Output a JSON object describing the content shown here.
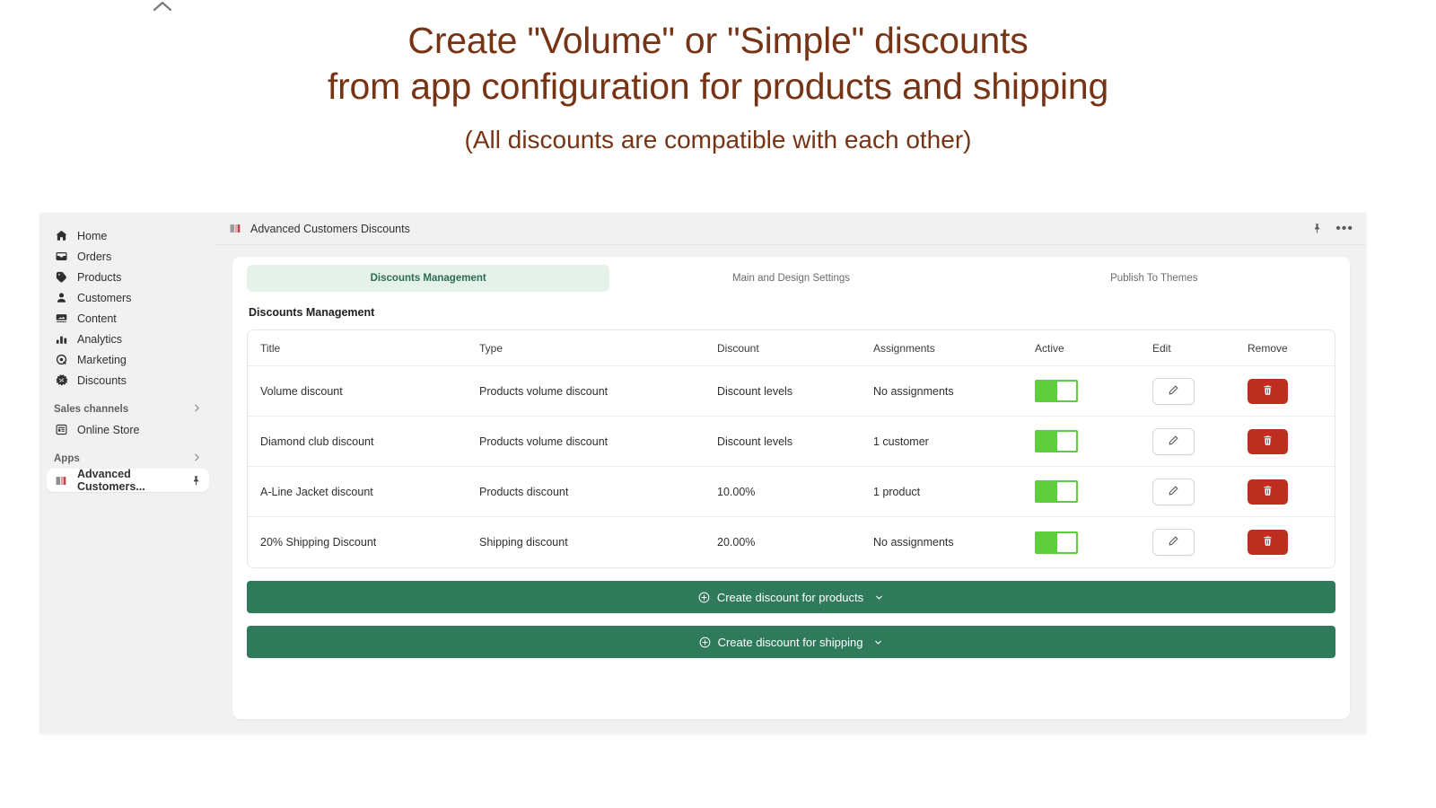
{
  "hero": {
    "headline_line1": "Create \"Volume\" or \"Simple\" discounts",
    "headline_line2": "from app configuration for products and shipping",
    "subheadline": "(All discounts are compatible with each other)",
    "headline_color": "#773415",
    "collapse_icon": "chevron-up-icon"
  },
  "sidebar": {
    "items": [
      {
        "label": "Home",
        "icon": "home-icon"
      },
      {
        "label": "Orders",
        "icon": "orders-inbox-icon"
      },
      {
        "label": "Products",
        "icon": "product-tag-icon"
      },
      {
        "label": "Customers",
        "icon": "person-icon"
      },
      {
        "label": "Content",
        "icon": "content-image-icon"
      },
      {
        "label": "Analytics",
        "icon": "bar-chart-icon"
      },
      {
        "label": "Marketing",
        "icon": "marketing-target-icon"
      },
      {
        "label": "Discounts",
        "icon": "discount-gear-icon"
      }
    ],
    "sections": [
      {
        "label": "Sales channels",
        "chevron": "chevron-right-icon",
        "items": [
          {
            "label": "Online Store",
            "icon": "storefront-icon"
          }
        ]
      },
      {
        "label": "Apps",
        "chevron": "chevron-right-icon",
        "items": [
          {
            "label": "Advanced Customers...",
            "icon": "app-logo-icon",
            "selected": true,
            "trailing_icon": "pin-icon"
          }
        ]
      }
    ]
  },
  "app_bar": {
    "logo_icon": "app-logo-icon",
    "title": "Advanced Customers Discounts",
    "pin_icon": "pin-icon",
    "more_icon": "more-horizontal-icon",
    "more_label": "•••"
  },
  "tabs": [
    {
      "label": "Discounts Management",
      "active": true
    },
    {
      "label": "Main and Design Settings",
      "active": false
    },
    {
      "label": "Publish To Themes",
      "active": false
    }
  ],
  "tab_colors": {
    "active_bg": "#e4f2e9",
    "active_text": "#2f6b4f",
    "inactive_text": "#6b6b6b"
  },
  "section": {
    "title": "Discounts Management"
  },
  "table": {
    "columns": [
      "Title",
      "Type",
      "Discount",
      "Assignments",
      "Active",
      "Edit",
      "Remove"
    ],
    "rows": [
      {
        "title": "Volume discount",
        "type": "Products volume discount",
        "discount": "Discount levels",
        "assignments": "No assignments",
        "active": true,
        "edit_icon": "pencil-icon",
        "remove_icon": "trash-icon"
      },
      {
        "title": "Diamond club discount",
        "type": "Products volume discount",
        "discount": "Discount levels",
        "assignments": "1 customer",
        "active": true,
        "edit_icon": "pencil-icon",
        "remove_icon": "trash-icon"
      },
      {
        "title": "A-Line Jacket discount",
        "type": "Products discount",
        "discount": "10.00%",
        "assignments": "1 product",
        "active": true,
        "edit_icon": "pencil-icon",
        "remove_icon": "trash-icon"
      },
      {
        "title": "20% Shipping Discount",
        "type": "Shipping discount",
        "discount": "20.00%",
        "assignments": "No assignments",
        "active": true,
        "edit_icon": "pencil-icon",
        "remove_icon": "trash-icon"
      }
    ]
  },
  "actions": {
    "create_products": "Create discount for products",
    "create_shipping": "Create discount for shipping",
    "plus_icon": "plus-circle-icon",
    "caret_icon": "chevron-down-icon"
  },
  "colors": {
    "toggle_on": "#5fce3e",
    "remove_red": "#bc2f20",
    "create_green": "#2f7a5b"
  }
}
